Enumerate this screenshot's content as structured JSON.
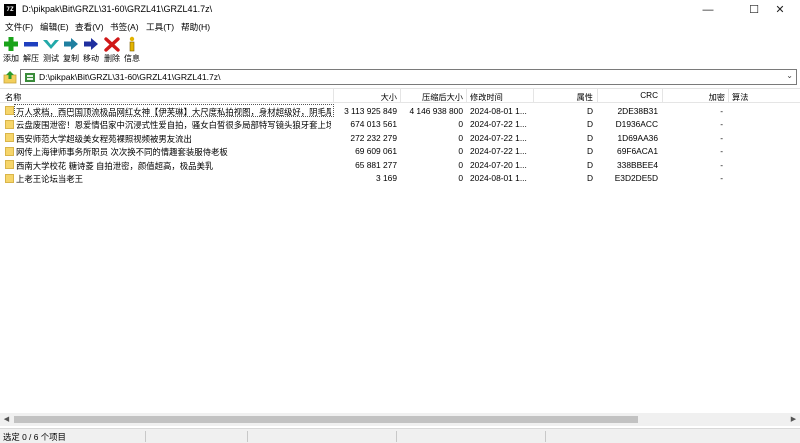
{
  "window": {
    "app_icon_text": "7Z",
    "title": "D:\\pikpak\\Bit\\GRZL\\31-60\\GRZL41\\GRZL41.7z\\",
    "minimize": "—",
    "maximize": "☐",
    "close": "✕"
  },
  "menu": [
    "文件(F)",
    "编辑(E)",
    "查看(V)",
    "书签(A)",
    "工具(T)",
    "帮助(H)"
  ],
  "toolbar": [
    {
      "label": "添加",
      "icon": "add-icon",
      "color": "#1aa31a"
    },
    {
      "label": "解压",
      "icon": "extract-icon",
      "color": "#1f3fbf"
    },
    {
      "label": "测试",
      "icon": "test-icon",
      "color": "#22a9a9"
    },
    {
      "label": "复制",
      "icon": "copy-icon",
      "color": "#1f7fa0"
    },
    {
      "label": "移动",
      "icon": "move-icon",
      "color": "#1f2f9f"
    },
    {
      "label": "删除",
      "icon": "delete-icon",
      "color": "#d01818"
    },
    {
      "label": "信息",
      "icon": "info-icon",
      "color": "#e3b400"
    }
  ],
  "address": {
    "path": "D:\\pikpak\\Bit\\GRZL\\31-60\\GRZL41\\GRZL41.7z\\"
  },
  "columns": {
    "name": "名称",
    "size": "大小",
    "packed": "压缩后大小",
    "modified": "修改时间",
    "attributes": "属性",
    "crc": "CRC",
    "encrypted": "加密",
    "method": "算法"
  },
  "rows": [
    {
      "name": "万人求档，西巴国顶流极品网红女神【伊芙琳】大尺度私拍视图，身材超级好，阴毛厚重...",
      "size": "3 113 925 849",
      "packed": "4 146 938 800",
      "modified": "2024-08-01 1...",
      "attr": "D",
      "crc": "2DE38B31",
      "enc": "-"
    },
    {
      "name": "云盘废围泄密！恩爱情侣家中沉浸式性爱自拍，骚女白皙很多局部特写镜头狼牙套上场制...",
      "size": "674 013 561",
      "packed": "0",
      "modified": "2024-07-22 1...",
      "attr": "D",
      "crc": "D1936ACC",
      "enc": "-"
    },
    {
      "name": "西安师范大学超级美女程苑裸照视频被男友流出",
      "size": "272 232 279",
      "packed": "0",
      "modified": "2024-07-22 1...",
      "attr": "D",
      "crc": "1D69AA36",
      "enc": "-"
    },
    {
      "name": "网传上海律师事务所职员 次次换不同的情趣套装服侍老板",
      "size": "69 609 061",
      "packed": "0",
      "modified": "2024-07-22 1...",
      "attr": "D",
      "crc": "69F6ACA1",
      "enc": "-"
    },
    {
      "name": "西南大学校花 糖诗菱 自拍泄密，颜值超高，极品美乳",
      "size": "65 881 277",
      "packed": "0",
      "modified": "2024-07-20 1...",
      "attr": "D",
      "crc": "338BBEE4",
      "enc": "-"
    },
    {
      "name": "上老王论坛当老王",
      "size": "3 169",
      "packed": "0",
      "modified": "2024-08-01 1...",
      "attr": "D",
      "crc": "E3D2DE5D",
      "enc": "-"
    }
  ],
  "status": {
    "selection": "选定 0 / 6 个项目"
  }
}
